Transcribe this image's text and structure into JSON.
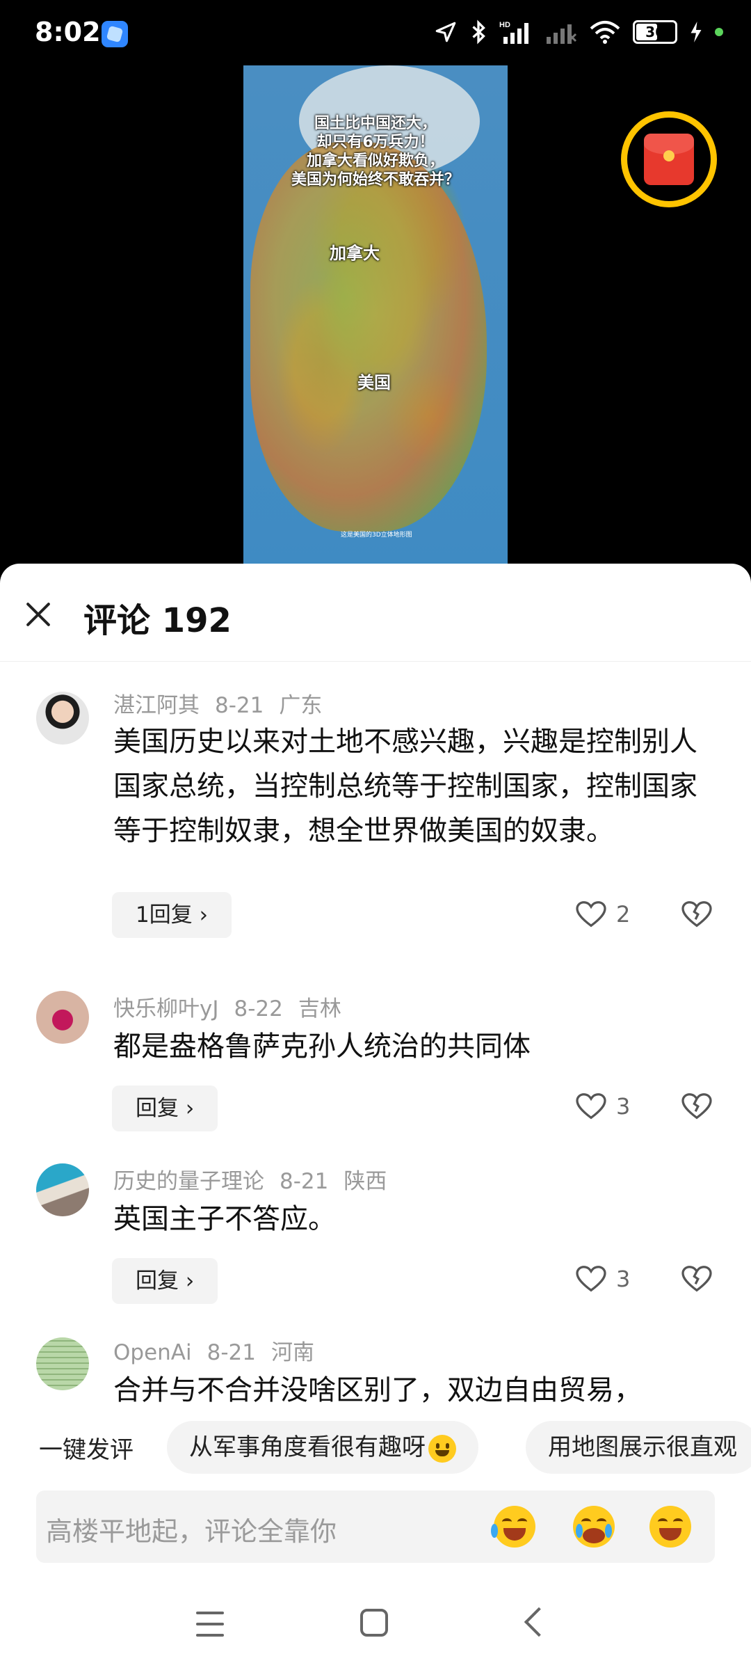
{
  "status_bar": {
    "time": "8:02",
    "battery": "36",
    "network": "HD"
  },
  "video": {
    "caption": "国土比中国还大，\n却只有6万兵力！\n加拿大看似好欺负，\n美国为何始终不敢吞并？",
    "label_canada": "加拿大",
    "label_usa": "美国",
    "tiny_text": "这是美国的3D立体地形图"
  },
  "sheet": {
    "title": "评论 192"
  },
  "comments": [
    {
      "user": "湛江阿其",
      "date": "8-21",
      "location": "广东",
      "text": "美国历史以来对土地不感兴趣，兴趣是控制别人国家总统，当控制总统等于控制国家，控制国家等于控制奴隶，想全世界做美国的奴隶。",
      "reply_label": "1回复 ›",
      "likes": "2"
    },
    {
      "user": "快乐柳叶yJ",
      "date": "8-22",
      "location": "吉林",
      "text": "都是盎格鲁萨克孙人统治的共同体",
      "reply_label": "回复 ›",
      "likes": "3"
    },
    {
      "user": "历史的量子理论",
      "date": "8-21",
      "location": "陕西",
      "text": "英国主子不答应。",
      "reply_label": "回复 ›",
      "likes": "3"
    },
    {
      "user": "OpenAi",
      "date": "8-21",
      "location": "河南",
      "text": "合并与不合并没啥区别了，双边自由贸易，"
    }
  ],
  "quick_comment": {
    "lead": "一键发评",
    "chips": [
      "从军事角度看很有趣呀",
      "用地图展示很直观"
    ]
  },
  "input": {
    "placeholder": "高楼平地起，评论全靠你"
  },
  "colors": {
    "accent_yellow": "#ffc400",
    "envelope_red": "#e7392d"
  }
}
